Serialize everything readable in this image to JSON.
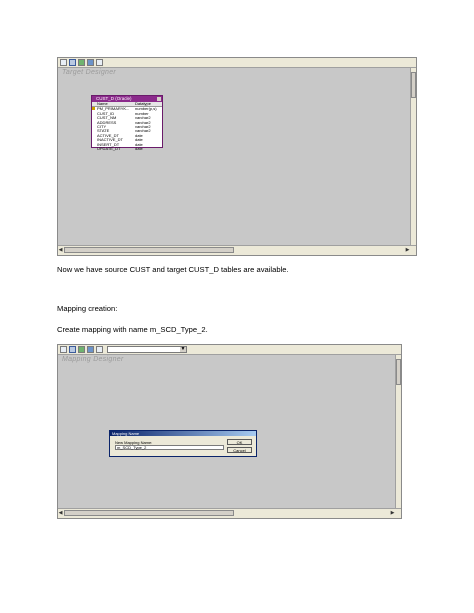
{
  "screenshot1": {
    "designer_title": "Target Designer",
    "table": {
      "title": "CUST_D (Oracle)",
      "header_name": "Name",
      "header_type": "Datatype",
      "rows": [
        {
          "name": "PM_PRIMARYK...",
          "type": "number(p,s)"
        },
        {
          "name": "CUST_ID",
          "type": "number"
        },
        {
          "name": "CUST_NM",
          "type": "varchar2"
        },
        {
          "name": "ADDRESS",
          "type": "varchar2"
        },
        {
          "name": "CITY",
          "type": "varchar2"
        },
        {
          "name": "STATE",
          "type": "varchar2"
        },
        {
          "name": "ACTIVE_DT",
          "type": "date"
        },
        {
          "name": "INACTIVE_DT",
          "type": "date"
        },
        {
          "name": "INSERT_DT",
          "type": "date"
        },
        {
          "name": "UPDATE_DT",
          "type": "date"
        }
      ]
    }
  },
  "text": {
    "para1": "Now we have source CUST and target CUST_D tables are available.",
    "para2": "Mapping creation:",
    "para3": "Create mapping with name m_SCD_Type_2."
  },
  "screenshot2": {
    "designer_title": "Mapping Designer",
    "dialog": {
      "title": "Mapping Name",
      "label": "New Mapping Name:",
      "value": "m_SCD_Type_2",
      "ok": "OK",
      "cancel": "Cancel"
    }
  }
}
